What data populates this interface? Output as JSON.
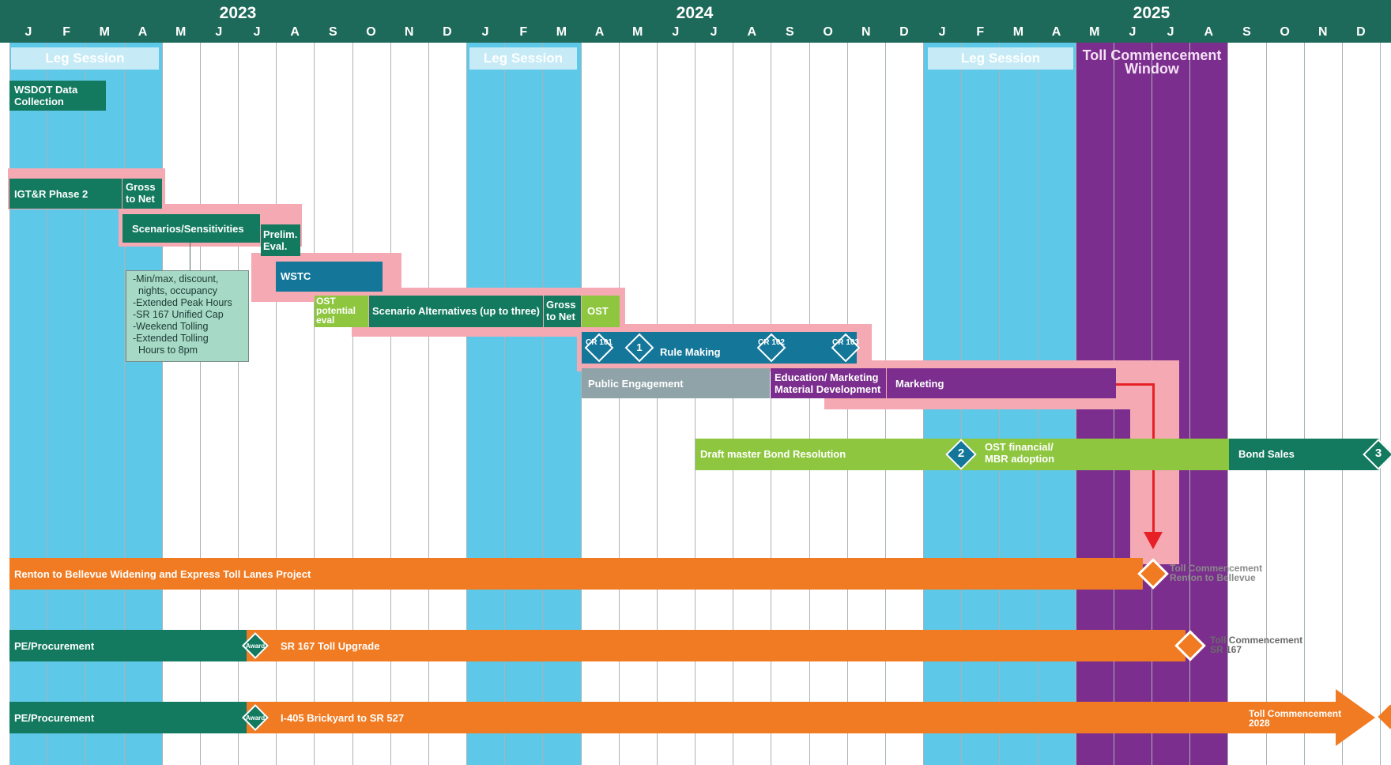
{
  "header": {
    "years": [
      "2023",
      "2024",
      "2025"
    ],
    "months": [
      "J",
      "F",
      "M",
      "A",
      "M",
      "J",
      "J",
      "A",
      "S",
      "O",
      "N",
      "D",
      "J",
      "F",
      "M",
      "A",
      "M",
      "J",
      "J",
      "A",
      "S",
      "O",
      "N",
      "D",
      "J",
      "F",
      "M",
      "A",
      "M",
      "J",
      "J",
      "A",
      "S",
      "O",
      "N",
      "D"
    ]
  },
  "bands": {
    "leg_sessions": [
      "Leg Session",
      "Leg Session",
      "Leg Session"
    ],
    "toll_window": "Toll Commencement Window"
  },
  "tasks": {
    "wsdot": "WSDOT Data Collection",
    "igtr": "IGT&R Phase 2",
    "gross_net_1": "Gross to Net",
    "scenarios": "Scenarios/Sensitivities",
    "prelim": "Prelim. Eval.",
    "wstc": "WSTC",
    "ost_potential": "OST potential eval",
    "scenario_alt": "Scenario Alternatives (up to three)",
    "gross_net_2": "Gross to Net",
    "ost": "OST",
    "rule_making": "Rule Making",
    "public_engagement": "Public Engagement",
    "education": "Education/ Marketing Material Development",
    "marketing": "Marketing",
    "draft_bond": "Draft master Bond Resolution",
    "ost_financial": "OST financial/ MBR adoption",
    "bond_sales": "Bond Sales"
  },
  "note_items": [
    "-Min/max, discount,",
    "  nights, occupancy",
    "-Extended Peak Hours",
    "-SR 167 Unified Cap",
    "-Weekend Tolling",
    "-Extended Tolling",
    "  Hours to 8pm"
  ],
  "milestones": {
    "cr101": "CR 101",
    "m1": "1",
    "cr102": "CR 102",
    "cr103": "CR 103",
    "m2": "2",
    "m3": "3",
    "award1": "Award",
    "award2": "Award"
  },
  "projects": {
    "renton": "Renton to Bellevue Widening and Express Toll Lanes Project",
    "renton_toll": "Toll Commencement Renton to Bellevue",
    "pe1": "PE/Procurement",
    "sr167": "SR 167 Toll Upgrade",
    "sr167_toll": "Toll Commencement SR 167",
    "pe2": "PE/Procurement",
    "i405": "I-405 Brickyard to SR 527",
    "i405_toll": "Toll Commencement 2028"
  },
  "colors": {
    "header": "#1e6a5a",
    "leg_session": "#5ec8e8",
    "toll_window": "#7b2e8e",
    "dark_green": "#137a5f",
    "teal_blue": "#14779a",
    "lime": "#8ec63f",
    "orange": "#f07b22",
    "pink": "#f4a9b3",
    "gray": "#8fa3a8",
    "purple": "#7b2e8e",
    "note_bg": "#a6d9c6",
    "red_arrow": "#e62024"
  }
}
